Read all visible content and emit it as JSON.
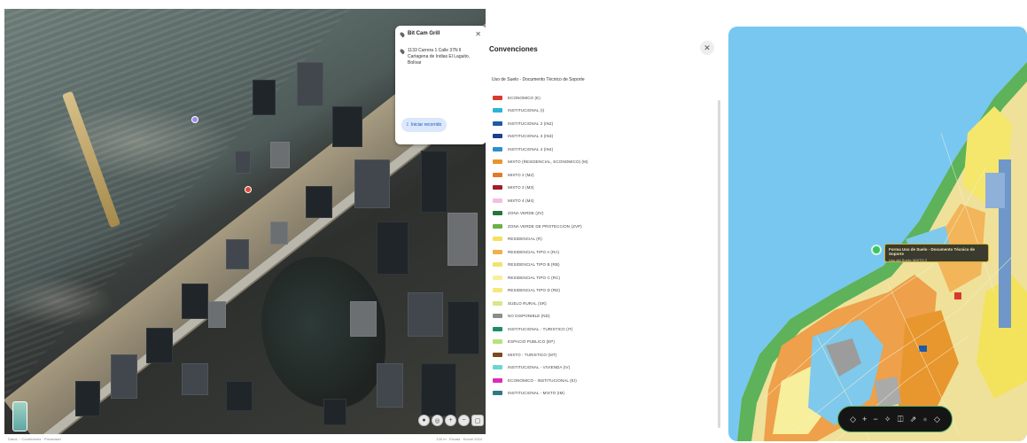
{
  "satellite": {
    "place_card": {
      "title": "Bit Cam Grill",
      "address": "1133 Carrera 1 Calle 37N ll Cartagena de Indias El Laguito, Bolívar",
      "route_button": "Iniciar recorrido"
    },
    "footer_left": "Datos ·· Condiciones · Privacidad",
    "footer_right": "100 m · Escala · Kurzel 2024"
  },
  "legend": {
    "title": "Convenciones",
    "subtitle": "Uso de Suelo - Documento Técnico de Soporte",
    "items": [
      {
        "label": "ECONOMICO (E)",
        "color": "#d83a2c"
      },
      {
        "label": "INSTITUCIONAL (I)",
        "color": "#29b5d6"
      },
      {
        "label": "INSTITUCIONAL 2 (IN2)",
        "color": "#1f5aa8"
      },
      {
        "label": "INSTITUCIONAL 3 (IN3)",
        "color": "#1c3f8f"
      },
      {
        "label": "INSTITUCIONAL 4 (IN4)",
        "color": "#2e8fcf"
      },
      {
        "label": "MIXTO (RESIDENCIAL, ECONOMICO) (M)",
        "color": "#e8962e"
      },
      {
        "label": "MIXTO 2 (M2)",
        "color": "#e37a2a"
      },
      {
        "label": "MIXTO 3 (M3)",
        "color": "#9e1f2a"
      },
      {
        "label": "MIXTO 4 (M4)",
        "color": "#f4bde3"
      },
      {
        "label": "ZONA VERDE (ZV)",
        "color": "#27733a"
      },
      {
        "label": "ZONA VERDE DE PROTECCION (ZVP)",
        "color": "#69b045"
      },
      {
        "label": "RESIDENCIAL (R)",
        "color": "#f3e25c"
      },
      {
        "label": "RESIDENCIAL TIPO A (RA)",
        "color": "#efb04a"
      },
      {
        "label": "RESIDENCIAL TIPO B (RB)",
        "color": "#f2e36e"
      },
      {
        "label": "RESIDENCIAL TIPO C (RC)",
        "color": "#f8ef9c"
      },
      {
        "label": "RESIDENCIAL TIPO D (RD)",
        "color": "#f6e87a"
      },
      {
        "label": "SUELO RURAL (SR)",
        "color": "#d7e78a"
      },
      {
        "label": "NO DISPONIBLE (ND)",
        "color": "#8c8c8c"
      },
      {
        "label": "INSTITUCIONAL - TURISTICO (IT)",
        "color": "#1c8c6c"
      },
      {
        "label": "ESPACIO PUBLICO (EP)",
        "color": "#b6e27a"
      },
      {
        "label": "MIXTO - TURISTICO (MT)",
        "color": "#7a4a1c"
      },
      {
        "label": "INSTITUCIONAL - VIVIENDA (IV)",
        "color": "#6ad6d2"
      },
      {
        "label": "ECONOMICO - INSTITUCIONAL (EI)",
        "color": "#d92cb8"
      },
      {
        "label": "INSTITUCIONAL - MIXTO (IM)",
        "color": "#2c7a86"
      }
    ]
  },
  "zoning_map": {
    "tooltip_title": "Forma Uso de Suelo - Documento Técnico de Soporte",
    "tooltip_value": "Uso del Suelo: MIXTO 2",
    "toolbar": [
      {
        "name": "rotate-left-icon",
        "glyph": "◇"
      },
      {
        "name": "zoom-in-icon",
        "glyph": "+"
      },
      {
        "name": "zoom-out-icon",
        "glyph": "−"
      },
      {
        "name": "locate-icon",
        "glyph": "✧"
      },
      {
        "name": "layers-icon",
        "glyph": "⎅"
      },
      {
        "name": "share-icon",
        "glyph": "⇗"
      },
      {
        "name": "info-icon",
        "glyph": "●"
      },
      {
        "name": "rotate-right-icon",
        "glyph": "◇"
      }
    ]
  }
}
